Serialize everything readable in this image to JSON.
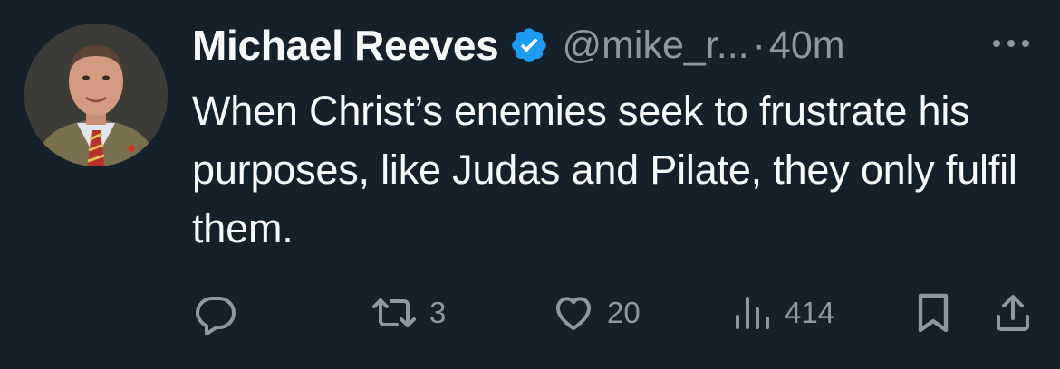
{
  "tweet": {
    "author_name": "Michael Reeves",
    "handle": "@mike_r...",
    "separator": "·",
    "time": "40m",
    "text": "When Christ’s enemies seek to frustrate his purposes, like Judas and Pilate, they only fulfil them.",
    "icons": {
      "verified": "verified-badge-icon",
      "more": "more-icon",
      "reply": "reply-icon",
      "retweet": "retweet-icon",
      "like": "like-icon",
      "views": "views-icon",
      "bookmark": "bookmark-icon",
      "share": "share-icon"
    }
  },
  "actions": {
    "reply_count": "",
    "retweet_count": "3",
    "like_count": "20",
    "views_count": "414"
  },
  "colors": {
    "background": "#15202b",
    "primary_text": "#f7f9f9",
    "secondary_text": "#8b98a5",
    "verified_blue": "#1d9bf0"
  }
}
